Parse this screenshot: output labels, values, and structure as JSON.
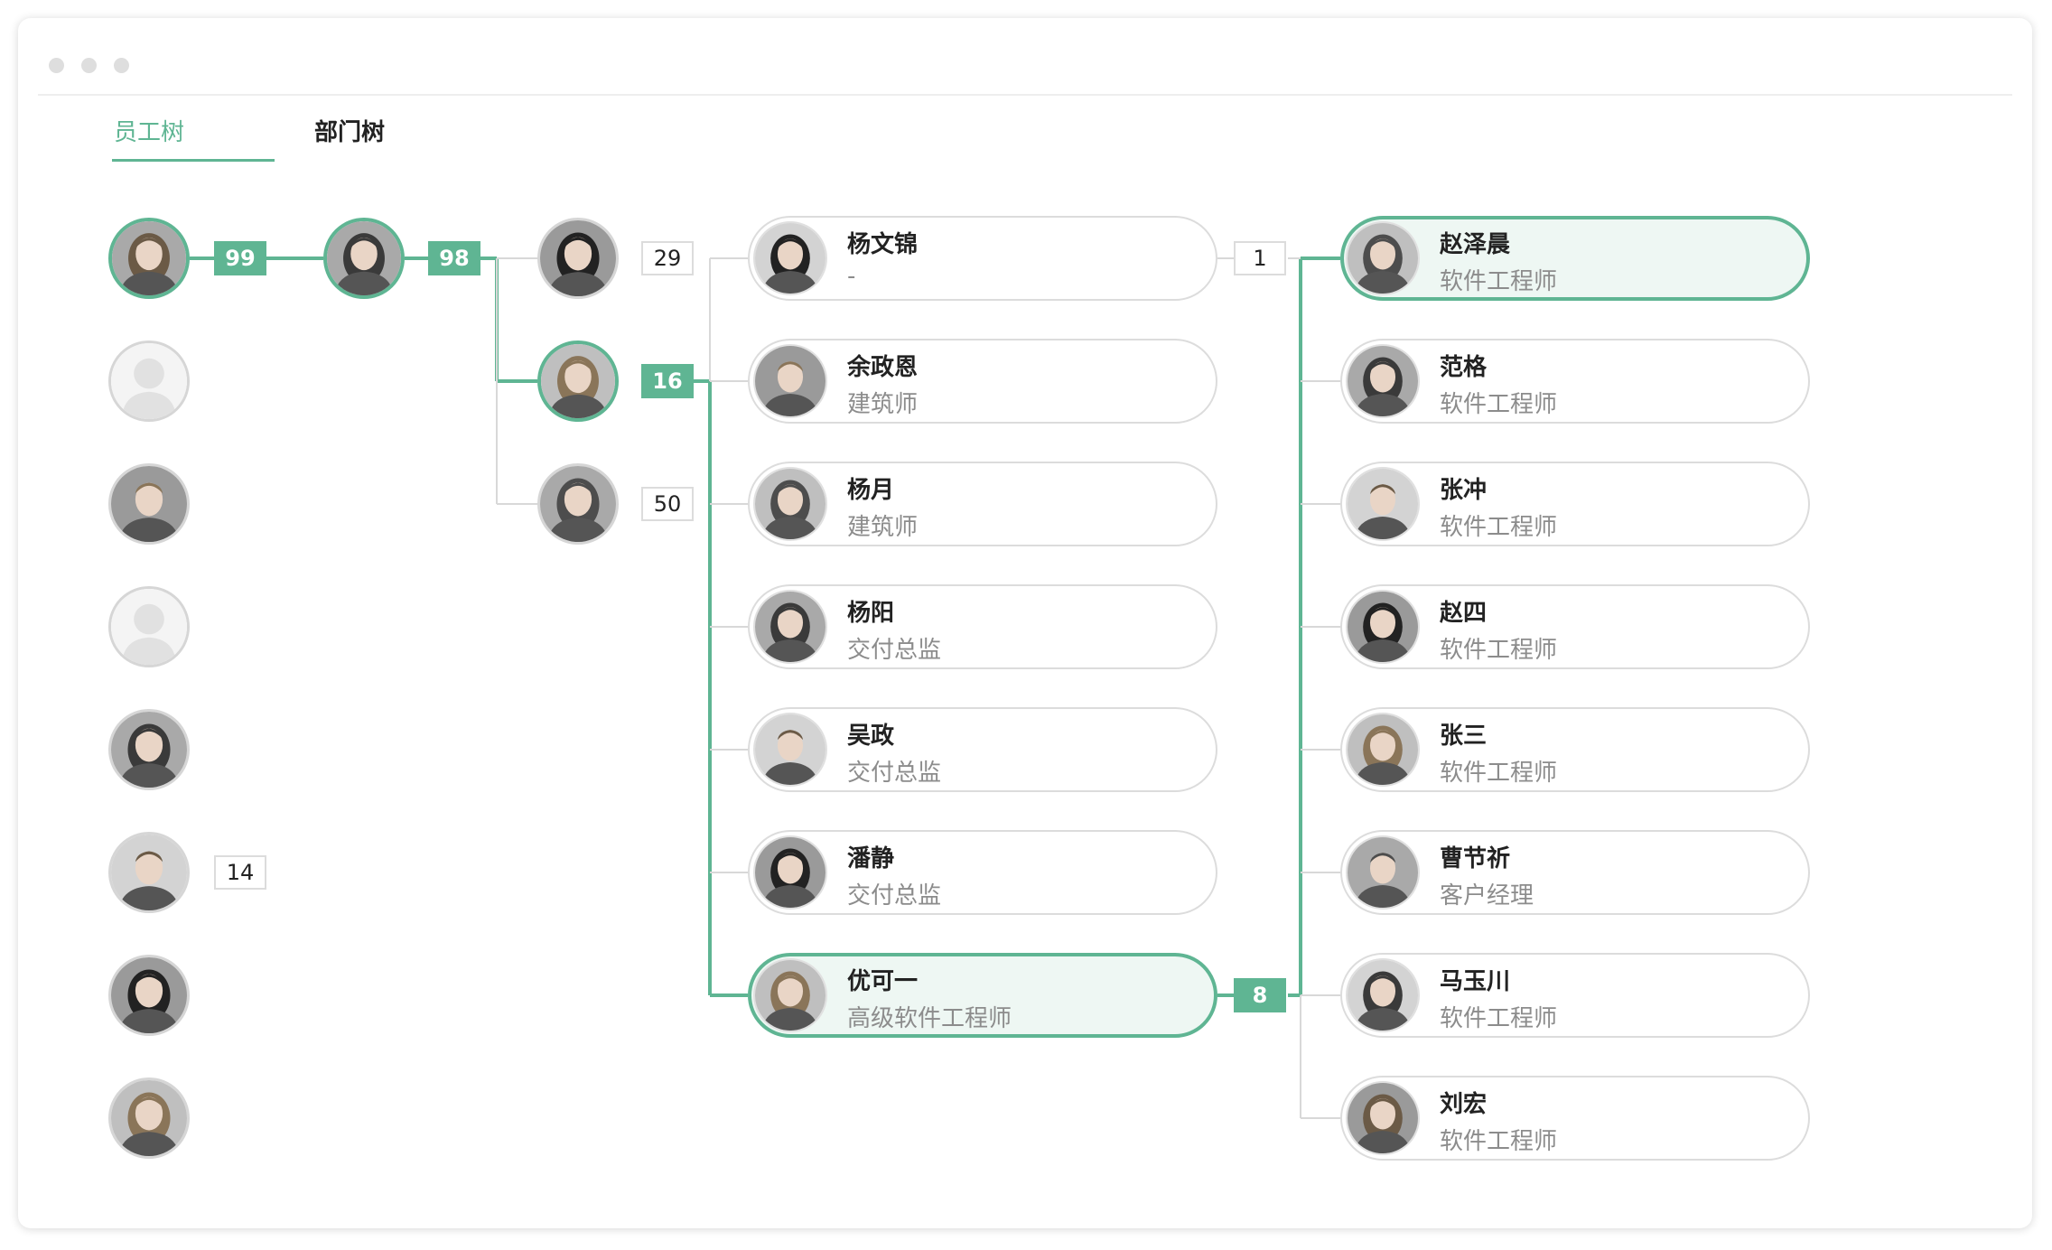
{
  "tabs": [
    {
      "label": "员工树",
      "active": true
    },
    {
      "label": "部门树",
      "active": false
    }
  ],
  "colors": {
    "accent": "#5fb593",
    "border": "#dcdcdc",
    "text": "#222222",
    "muted": "#8c8c8c"
  },
  "column1": [
    {
      "avatar": "female-photo-icon",
      "badge": "99",
      "active": true
    },
    {
      "avatar": "default-user-icon"
    },
    {
      "avatar": "male-photo-icon"
    },
    {
      "avatar": "default-user-icon"
    },
    {
      "avatar": "female-photo-icon"
    },
    {
      "avatar": "male-photo-icon",
      "badge": "14"
    },
    {
      "avatar": "female-photo-icon"
    },
    {
      "avatar": "female-photo-icon"
    }
  ],
  "column2": [
    {
      "avatar": "female-photo-icon",
      "badge": "98",
      "active": true
    }
  ],
  "column3": [
    {
      "avatar": "female-photo-icon",
      "badge": "29"
    },
    {
      "avatar": "female-photo-icon",
      "badge": "16",
      "active": true
    },
    {
      "avatar": "female-photo-icon",
      "badge": "50"
    }
  ],
  "column4": [
    {
      "name": "杨文锦",
      "title": "-",
      "badge": "1"
    },
    {
      "name": "余政恩",
      "title": "建筑师"
    },
    {
      "name": "杨月",
      "title": "建筑师"
    },
    {
      "name": "杨阳",
      "title": "交付总监"
    },
    {
      "name": "吴政",
      "title": "交付总监"
    },
    {
      "name": "潘静",
      "title": "交付总监"
    },
    {
      "name": "优可一",
      "title": "高级软件工程师",
      "badge": "8",
      "active": true
    }
  ],
  "column5": [
    {
      "name": "赵泽晨",
      "title": "软件工程师",
      "active": true
    },
    {
      "name": "范格",
      "title": "软件工程师"
    },
    {
      "name": "张冲",
      "title": "软件工程师"
    },
    {
      "name": "赵四",
      "title": "软件工程师"
    },
    {
      "name": "张三",
      "title": "软件工程师"
    },
    {
      "name": "曹节祈",
      "title": "客户经理"
    },
    {
      "name": "马玉川",
      "title": "软件工程师"
    },
    {
      "name": "刘宏",
      "title": "软件工程师"
    }
  ]
}
